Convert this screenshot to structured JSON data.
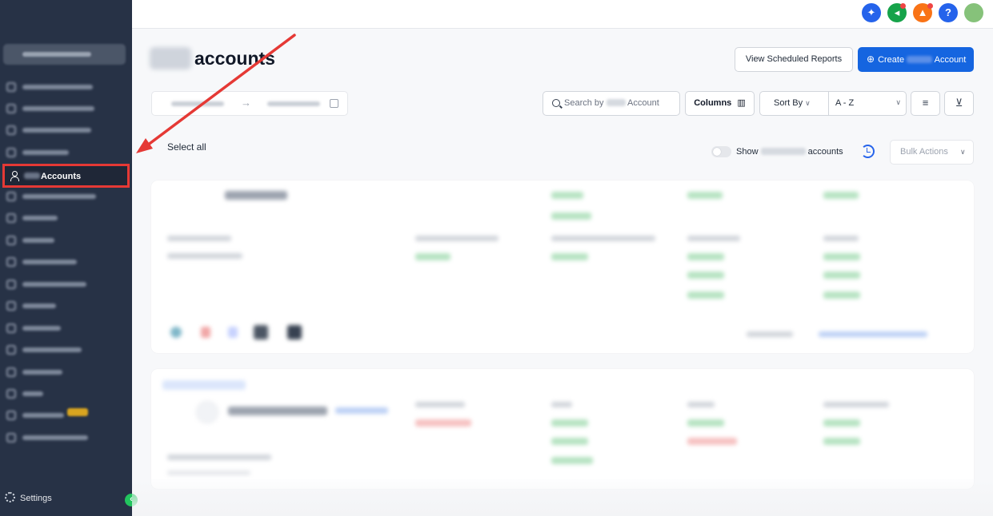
{
  "sidebar": {
    "active_item": "Accounts",
    "settings_label": "Settings",
    "collapse_glyph": "‹"
  },
  "header": {
    "title": "accounts",
    "view_reports": "View Scheduled Reports",
    "create_prefix": "Create",
    "create_suffix": "Account"
  },
  "filters": {
    "date_arrow": "→",
    "search_prefix": "Search by",
    "search_suffix": "Account",
    "columns": "Columns",
    "sort_by": "Sort By",
    "sort_value": "A - Z"
  },
  "list": {
    "select_all": "Select all",
    "show_prefix": "Show",
    "show_suffix": "accounts",
    "bulk_actions": "Bulk Actions"
  },
  "topbar": {
    "help_glyph": "?"
  },
  "colors": {
    "sidebar": "#273246",
    "accent": "#1565e0",
    "highlight": "#e53935"
  }
}
